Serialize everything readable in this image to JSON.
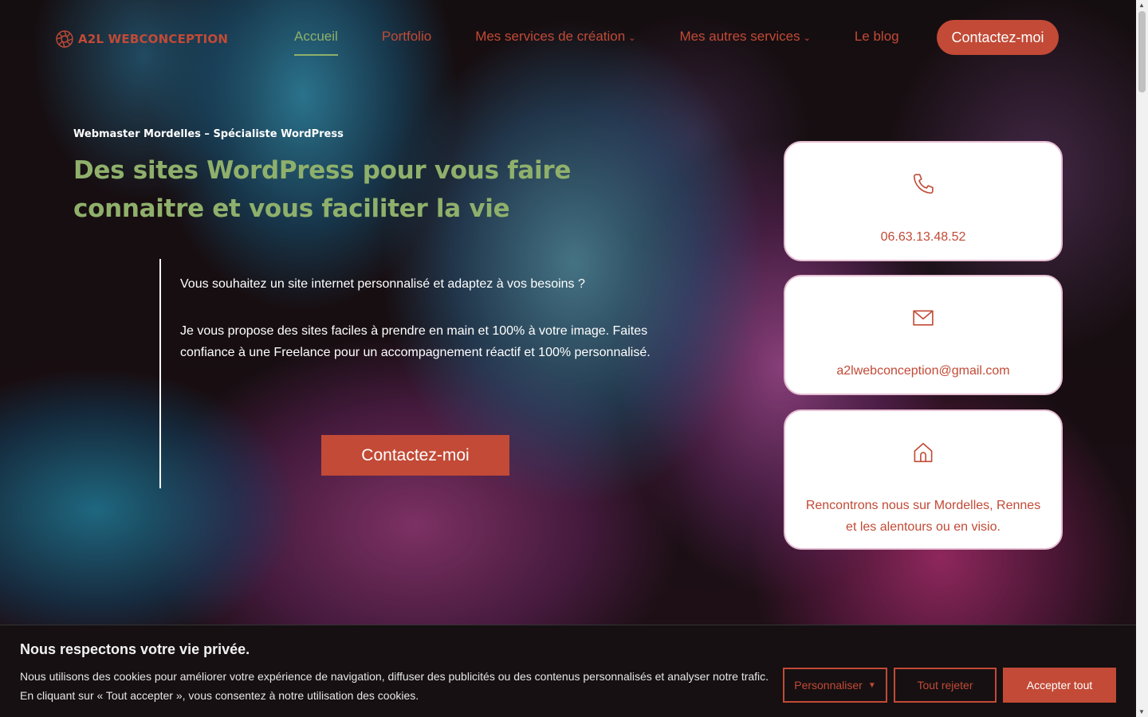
{
  "brand": {
    "name": "A2L WEBCONCEPTION",
    "accent": "#c24a36",
    "green": "#8fb06b"
  },
  "nav": {
    "items": [
      {
        "label": "Accueil",
        "active": true,
        "dropdown": false
      },
      {
        "label": "Portfolio",
        "active": false,
        "dropdown": false
      },
      {
        "label": "Mes services de création",
        "active": false,
        "dropdown": true
      },
      {
        "label": "Mes autres services",
        "active": false,
        "dropdown": true
      },
      {
        "label": "Le blog",
        "active": false,
        "dropdown": false
      }
    ],
    "cta": "Contactez-moi"
  },
  "hero": {
    "eyebrow": "Webmaster Mordelles – Spécialiste WordPress",
    "title": "Des sites WordPress pour vous faire connaitre et vous faciliter la vie",
    "paragraph1": "Vous souhaitez un site internet personnalisé et adaptez à vos besoins ?",
    "paragraph2": "Je vous propose des sites faciles à prendre en main et 100% à votre image. Faites confiance à une Freelance pour un accompagnement réactif et 100% personnalisé.",
    "cta": "Contactez-moi"
  },
  "contact_cards": {
    "phone": {
      "icon": "phone-icon",
      "text": "06.63.13.48.52"
    },
    "email": {
      "icon": "mail-icon",
      "text": "a2lwebconception@gmail.com"
    },
    "location": {
      "icon": "home-icon",
      "text": "Rencontrons nous sur Mordelles, Rennes et les alentours ou en visio."
    }
  },
  "cookie_banner": {
    "title": "Nous respectons votre vie privée.",
    "text": "Nous utilisons des cookies pour améliorer votre expérience de navigation, diffuser des publicités ou des contenus personnalisés et analyser notre trafic. En cliquant sur « Tout accepter », vous consentez à notre utilisation des cookies.",
    "customize": "Personnaliser",
    "reject": "Tout rejeter",
    "accept": "Accepter tout"
  }
}
